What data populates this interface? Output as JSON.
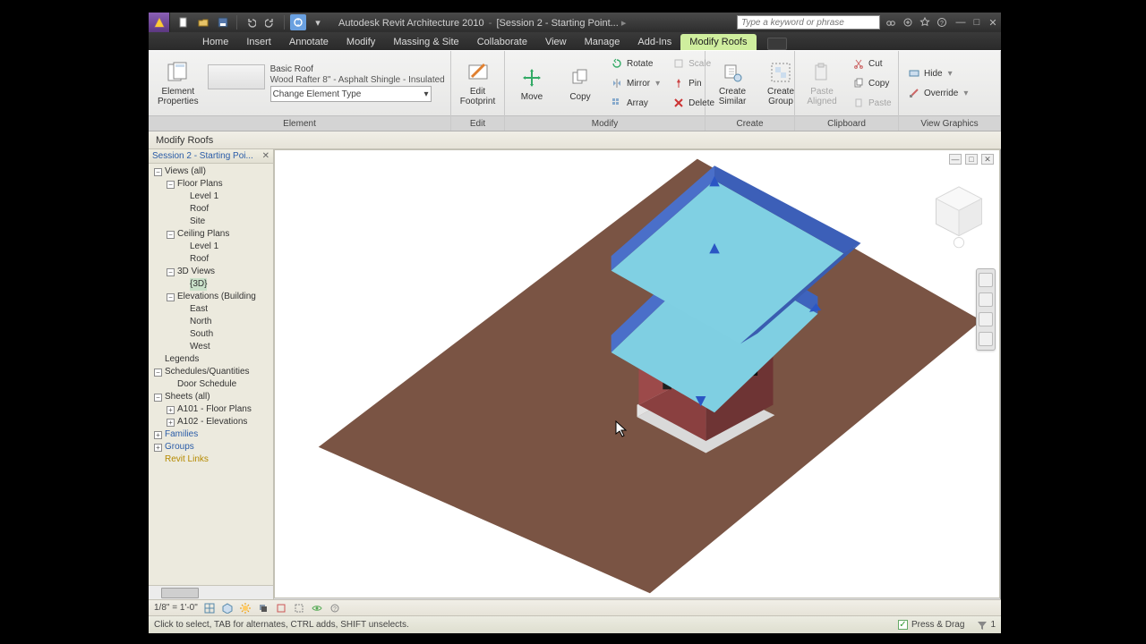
{
  "title": {
    "product": "Autodesk Revit Architecture 2010",
    "doc": "[Session 2 - Starting Point...",
    "search_placeholder": "Type a keyword or phrase"
  },
  "tabs": [
    "Home",
    "Insert",
    "Annotate",
    "Modify",
    "Massing & Site",
    "Collaborate",
    "View",
    "Manage",
    "Add-Ins",
    "Modify Roofs"
  ],
  "active_tab": 9,
  "option_bar": "Modify Roofs",
  "ribbon": {
    "element": {
      "caption": "Element",
      "element_properties": "Element\nProperties",
      "type_name": "Basic Roof",
      "type_desc": "Wood Rafter 8\" - Asphalt Shingle - Insulated",
      "change_type": "Change Element Type"
    },
    "edit": {
      "caption": "Edit",
      "edit_footprint": "Edit\nFootprint"
    },
    "modify": {
      "caption": "Modify",
      "move": "Move",
      "copy": "Copy",
      "rotate": "Rotate",
      "mirror": "Mirror",
      "array": "Array",
      "scale": "Scale",
      "pin": "Pin",
      "delete": "Delete"
    },
    "create": {
      "caption": "Create",
      "create_similar": "Create\nSimilar",
      "create_group": "Create\nGroup"
    },
    "clipboard": {
      "caption": "Clipboard",
      "paste_aligned": "Paste\nAligned",
      "cut": "Cut",
      "copy": "Copy",
      "paste": "Paste"
    },
    "viewgraphics": {
      "caption": "View Graphics",
      "hide": "Hide",
      "override": "Override"
    }
  },
  "browser": {
    "title": "Session 2 - Starting Poi...",
    "tree": [
      {
        "d": 0,
        "e": "-",
        "t": "Views (all)"
      },
      {
        "d": 1,
        "e": "-",
        "t": "Floor Plans"
      },
      {
        "d": 2,
        "e": " ",
        "t": "Level 1"
      },
      {
        "d": 2,
        "e": " ",
        "t": "Roof"
      },
      {
        "d": 2,
        "e": " ",
        "t": "Site"
      },
      {
        "d": 1,
        "e": "-",
        "t": "Ceiling Plans"
      },
      {
        "d": 2,
        "e": " ",
        "t": "Level 1"
      },
      {
        "d": 2,
        "e": " ",
        "t": "Roof"
      },
      {
        "d": 1,
        "e": "-",
        "t": "3D Views"
      },
      {
        "d": 2,
        "e": " ",
        "t": "{3D}",
        "sel": true
      },
      {
        "d": 1,
        "e": "-",
        "t": "Elevations (Building"
      },
      {
        "d": 2,
        "e": " ",
        "t": "East"
      },
      {
        "d": 2,
        "e": " ",
        "t": "North"
      },
      {
        "d": 2,
        "e": " ",
        "t": "South"
      },
      {
        "d": 2,
        "e": " ",
        "t": "West"
      },
      {
        "d": 0,
        "e": " ",
        "t": "Legends"
      },
      {
        "d": 0,
        "e": "-",
        "t": "Schedules/Quantities"
      },
      {
        "d": 1,
        "e": " ",
        "t": "Door Schedule"
      },
      {
        "d": 0,
        "e": "-",
        "t": "Sheets (all)"
      },
      {
        "d": 1,
        "e": "+",
        "t": "A101 - Floor Plans"
      },
      {
        "d": 1,
        "e": "+",
        "t": "A102 - Elevations"
      },
      {
        "d": 0,
        "e": "+",
        "t": "Families",
        "cls": "link"
      },
      {
        "d": 0,
        "e": "+",
        "t": "Groups",
        "cls": "link"
      },
      {
        "d": 0,
        "e": " ",
        "t": "Revit Links",
        "cls": "gold"
      }
    ]
  },
  "viewctrl": {
    "scale": "1/8\" = 1'-0\""
  },
  "status": {
    "hint": "Click to select, TAB for alternates, CTRL adds, SHIFT unselects.",
    "press_drag": "Press & Drag",
    "filter_count": "1"
  },
  "colors": {
    "ground": "#7a5444",
    "roof_side": "#4a74c9",
    "roof_top": "#7ecde0",
    "wall": "#9c4a4a",
    "wall_dark": "#6e3737",
    "foundation": "#d6d6d6"
  }
}
